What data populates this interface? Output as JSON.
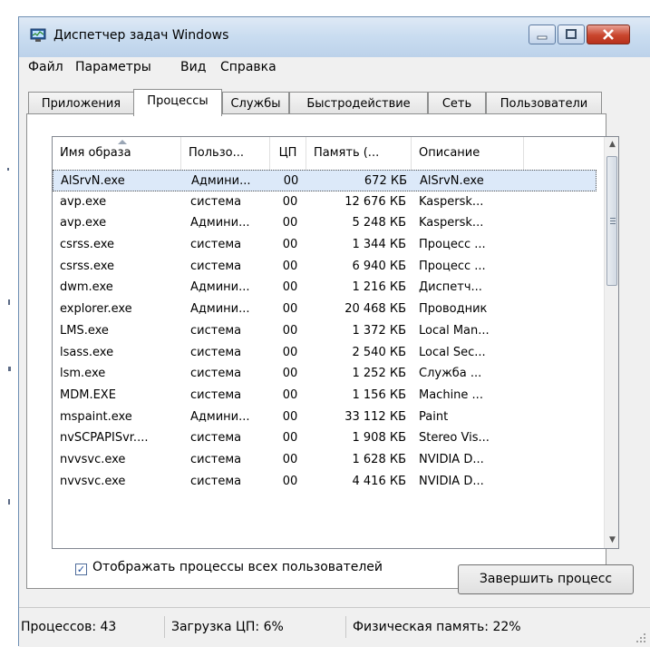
{
  "window": {
    "title": "Диспетчер задач Windows"
  },
  "menu": [
    "Файл",
    "Параметры",
    "Вид",
    "Справка"
  ],
  "tabs": [
    "Приложения",
    "Процессы",
    "Службы",
    "Быстродействие",
    "Сеть",
    "Пользователи"
  ],
  "active_tab": "Процессы",
  "columns": [
    "Имя образа",
    "Пользо...",
    "ЦП",
    "Память (...",
    "Описание"
  ],
  "rows": [
    {
      "name": "AlSrvN.exe",
      "user": "Админи...",
      "cpu": "00",
      "mem": "672 КБ",
      "desc": "AlSrvN.exe"
    },
    {
      "name": "avp.exe",
      "user": "система",
      "cpu": "00",
      "mem": "12 676 КБ",
      "desc": "Kaspersk..."
    },
    {
      "name": "avp.exe",
      "user": "Админи...",
      "cpu": "00",
      "mem": "5 248 КБ",
      "desc": "Kaspersk..."
    },
    {
      "name": "csrss.exe",
      "user": "система",
      "cpu": "00",
      "mem": "1 344 КБ",
      "desc": "Процесс ..."
    },
    {
      "name": "csrss.exe",
      "user": "система",
      "cpu": "00",
      "mem": "6 940 КБ",
      "desc": "Процесс ..."
    },
    {
      "name": "dwm.exe",
      "user": "Админи...",
      "cpu": "00",
      "mem": "1 216 КБ",
      "desc": "Диспетч..."
    },
    {
      "name": "explorer.exe",
      "user": "Админи...",
      "cpu": "00",
      "mem": "20 468 КБ",
      "desc": "Проводник"
    },
    {
      "name": "LMS.exe",
      "user": "система",
      "cpu": "00",
      "mem": "1 372 КБ",
      "desc": "Local Man..."
    },
    {
      "name": "lsass.exe",
      "user": "система",
      "cpu": "00",
      "mem": "2 540 КБ",
      "desc": "Local Sec..."
    },
    {
      "name": "lsm.exe",
      "user": "система",
      "cpu": "00",
      "mem": "1 252 КБ",
      "desc": "Служба ..."
    },
    {
      "name": "MDM.EXE",
      "user": "система",
      "cpu": "00",
      "mem": "1 156 КБ",
      "desc": "Machine ..."
    },
    {
      "name": "mspaint.exe",
      "user": "Админи...",
      "cpu": "00",
      "mem": "33 112 КБ",
      "desc": "Paint"
    },
    {
      "name": "nvSCPAPISvr....",
      "user": "система",
      "cpu": "00",
      "mem": "1 908 КБ",
      "desc": "Stereo Vis..."
    },
    {
      "name": "nvvsvc.exe",
      "user": "система",
      "cpu": "00",
      "mem": "1 628 КБ",
      "desc": "NVIDIA D..."
    },
    {
      "name": "nvvsvc.exe",
      "user": "система",
      "cpu": "00",
      "mem": "4 416 КБ",
      "desc": "NVIDIA D..."
    }
  ],
  "options": {
    "show_all_label": "Отображать процессы всех пользователей",
    "show_all_checked": true,
    "checkmark": "✓",
    "end_process_label": "Завершить процесс"
  },
  "statusbar": {
    "processes": "Процессов: 43",
    "cpu": "Загрузка ЦП: 6%",
    "memory": "Физическая память: 22%"
  },
  "icons": {
    "minimize": "minimize-icon",
    "maximize": "maximize-icon",
    "close": "close-icon",
    "scroll_up": "▲",
    "scroll_down": "▼"
  },
  "colors": {
    "selection": "#dce9f9",
    "close_button": "#c9452d",
    "titlebar": "#c9dcf0"
  }
}
